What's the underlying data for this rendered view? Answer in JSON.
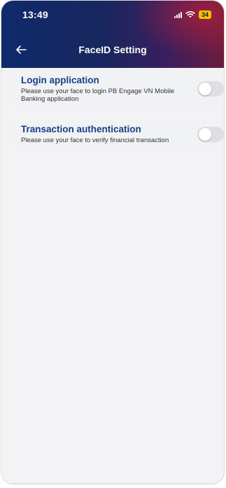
{
  "status_bar": {
    "time": "13:49",
    "battery": "34"
  },
  "header": {
    "title": "FaceID Setting",
    "back_icon": "back-arrow-icon"
  },
  "settings": [
    {
      "title": "Login application",
      "description": "Please use your face to login PB Engage VN Mobile Banking application",
      "enabled": false
    },
    {
      "title": "Transaction authentication",
      "description": "Please use your face to verify financial transaction",
      "enabled": false
    }
  ],
  "colors": {
    "title_blue": "#163f86",
    "header_start": "#0f2a6b",
    "header_end": "#6a1d3f",
    "battery": "#f2c200"
  }
}
